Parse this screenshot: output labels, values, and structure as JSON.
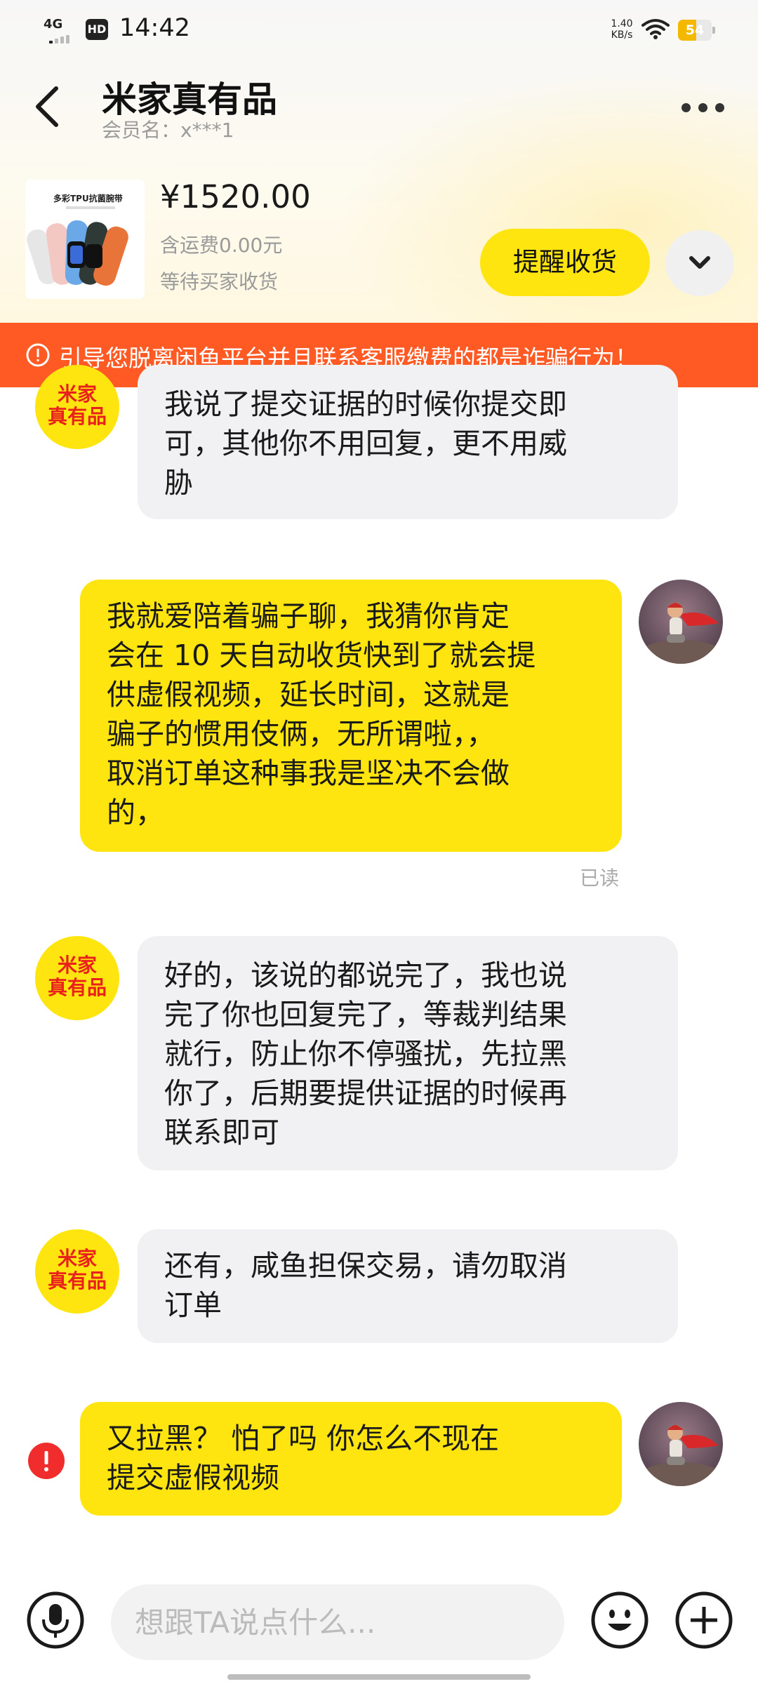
{
  "status_bar": {
    "network": "4G",
    "hd": "HD",
    "time": "14:42",
    "speed_value": "1.40",
    "speed_unit": "KB/s",
    "battery": "54"
  },
  "header": {
    "shop_name": "米家真有品",
    "member_label": "会员名：",
    "member_value": "x***1"
  },
  "product": {
    "image_caption": "多彩TPU抗菌腕带",
    "price": "¥1520.00",
    "shipping": "含运费0.00元",
    "status": "等待买家收货",
    "remind_button": "提醒收货"
  },
  "warning": {
    "text": "引导您脱离闲鱼平台并且联系客服缴费的都是诈骗行为！"
  },
  "shop_avatar": {
    "line1": "米家",
    "line2": "真有品"
  },
  "messages": [
    {
      "sender": "shop",
      "lines": [
        "我说了提交证据的时候你提交即",
        "可，其他你不用回复，更不用威",
        "胁"
      ]
    },
    {
      "sender": "me",
      "lines": [
        "我就爱陪着骗子聊，我猜你肯定",
        "会在 10 天自动收货快到了就会提",
        "供虚假视频，延长时间，这就是",
        "骗子的惯用伎俩，无所谓啦，，",
        "取消订单这种事我是坚决不会做",
        "的，"
      ]
    },
    {
      "sender": "shop",
      "lines": [
        "好的，该说的都说完了，我也说",
        "完了你也回复完了，等裁判结果",
        "就行，防止你不停骚扰，先拉黑",
        "你了，后期要提供证据的时候再",
        "联系即可"
      ]
    },
    {
      "sender": "shop",
      "lines": [
        "还有，咸鱼担保交易，请勿取消",
        "订单"
      ]
    },
    {
      "sender": "me",
      "lines": [
        "又拉黑？ 怕了吗 你怎么不现在",
        "提交虚假视频"
      ]
    }
  ],
  "read_receipt": "已读",
  "input": {
    "placeholder": "想跟TA说点什么..."
  },
  "colors": {
    "accent_yellow": "#ffe50f",
    "warning_orange": "#ff5a24",
    "incoming_bubble": "#f1f1f3",
    "error_red": "#f02c2c",
    "shop_avatar_text": "#e8211c"
  },
  "icons": [
    "back-arrow-icon",
    "more-dots-icon",
    "chevron-down-icon",
    "warning-circle-icon",
    "microphone-icon",
    "emoji-icon",
    "plus-circle-icon",
    "error-icon"
  ]
}
